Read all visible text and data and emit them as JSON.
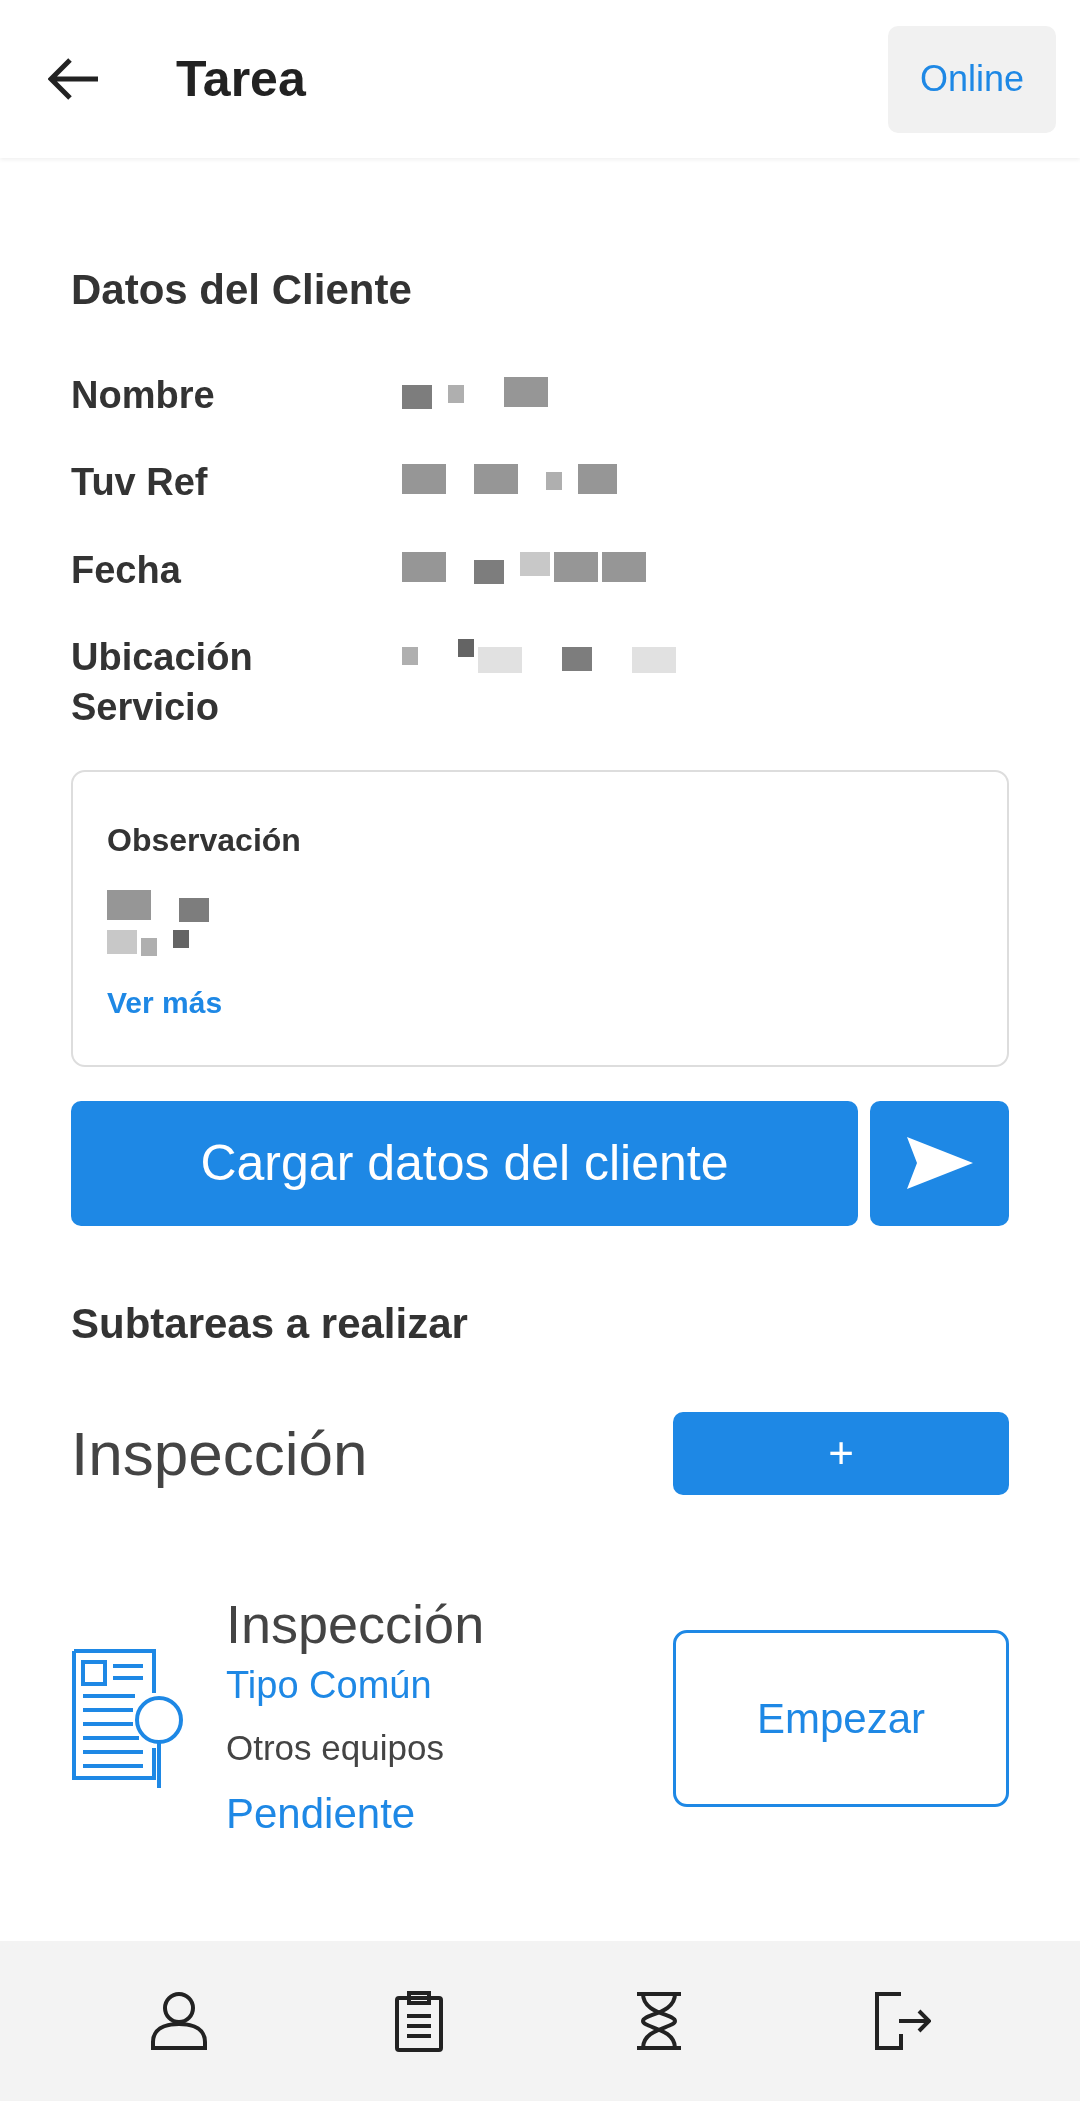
{
  "app_bar": {
    "title": "Tarea",
    "status_button": "Online"
  },
  "client_section": {
    "heading": "Datos del Cliente",
    "fields": [
      {
        "label": "Nombre",
        "value_redacted": true
      },
      {
        "label": "Tuv Ref",
        "value_redacted": true
      },
      {
        "label": "Fecha",
        "value_redacted": true
      },
      {
        "label": "Ubicación Servicio",
        "value_redacted": true
      }
    ]
  },
  "observation": {
    "title": "Observación",
    "text_redacted": true,
    "more_link": "Ver más"
  },
  "load_button": "Cargar datos del cliente",
  "subtasks": {
    "heading": "Subtareas a realizar",
    "group_title": "Inspección",
    "add_button": "+",
    "items": [
      {
        "title": "Inspección",
        "type": "Tipo Común",
        "equipment": "Otros equipos",
        "status": "Pendiente",
        "action": "Empezar"
      }
    ]
  },
  "bottom_nav": [
    {
      "kind": "profile"
    },
    {
      "kind": "tasks"
    },
    {
      "kind": "pending"
    },
    {
      "kind": "logout"
    }
  ]
}
